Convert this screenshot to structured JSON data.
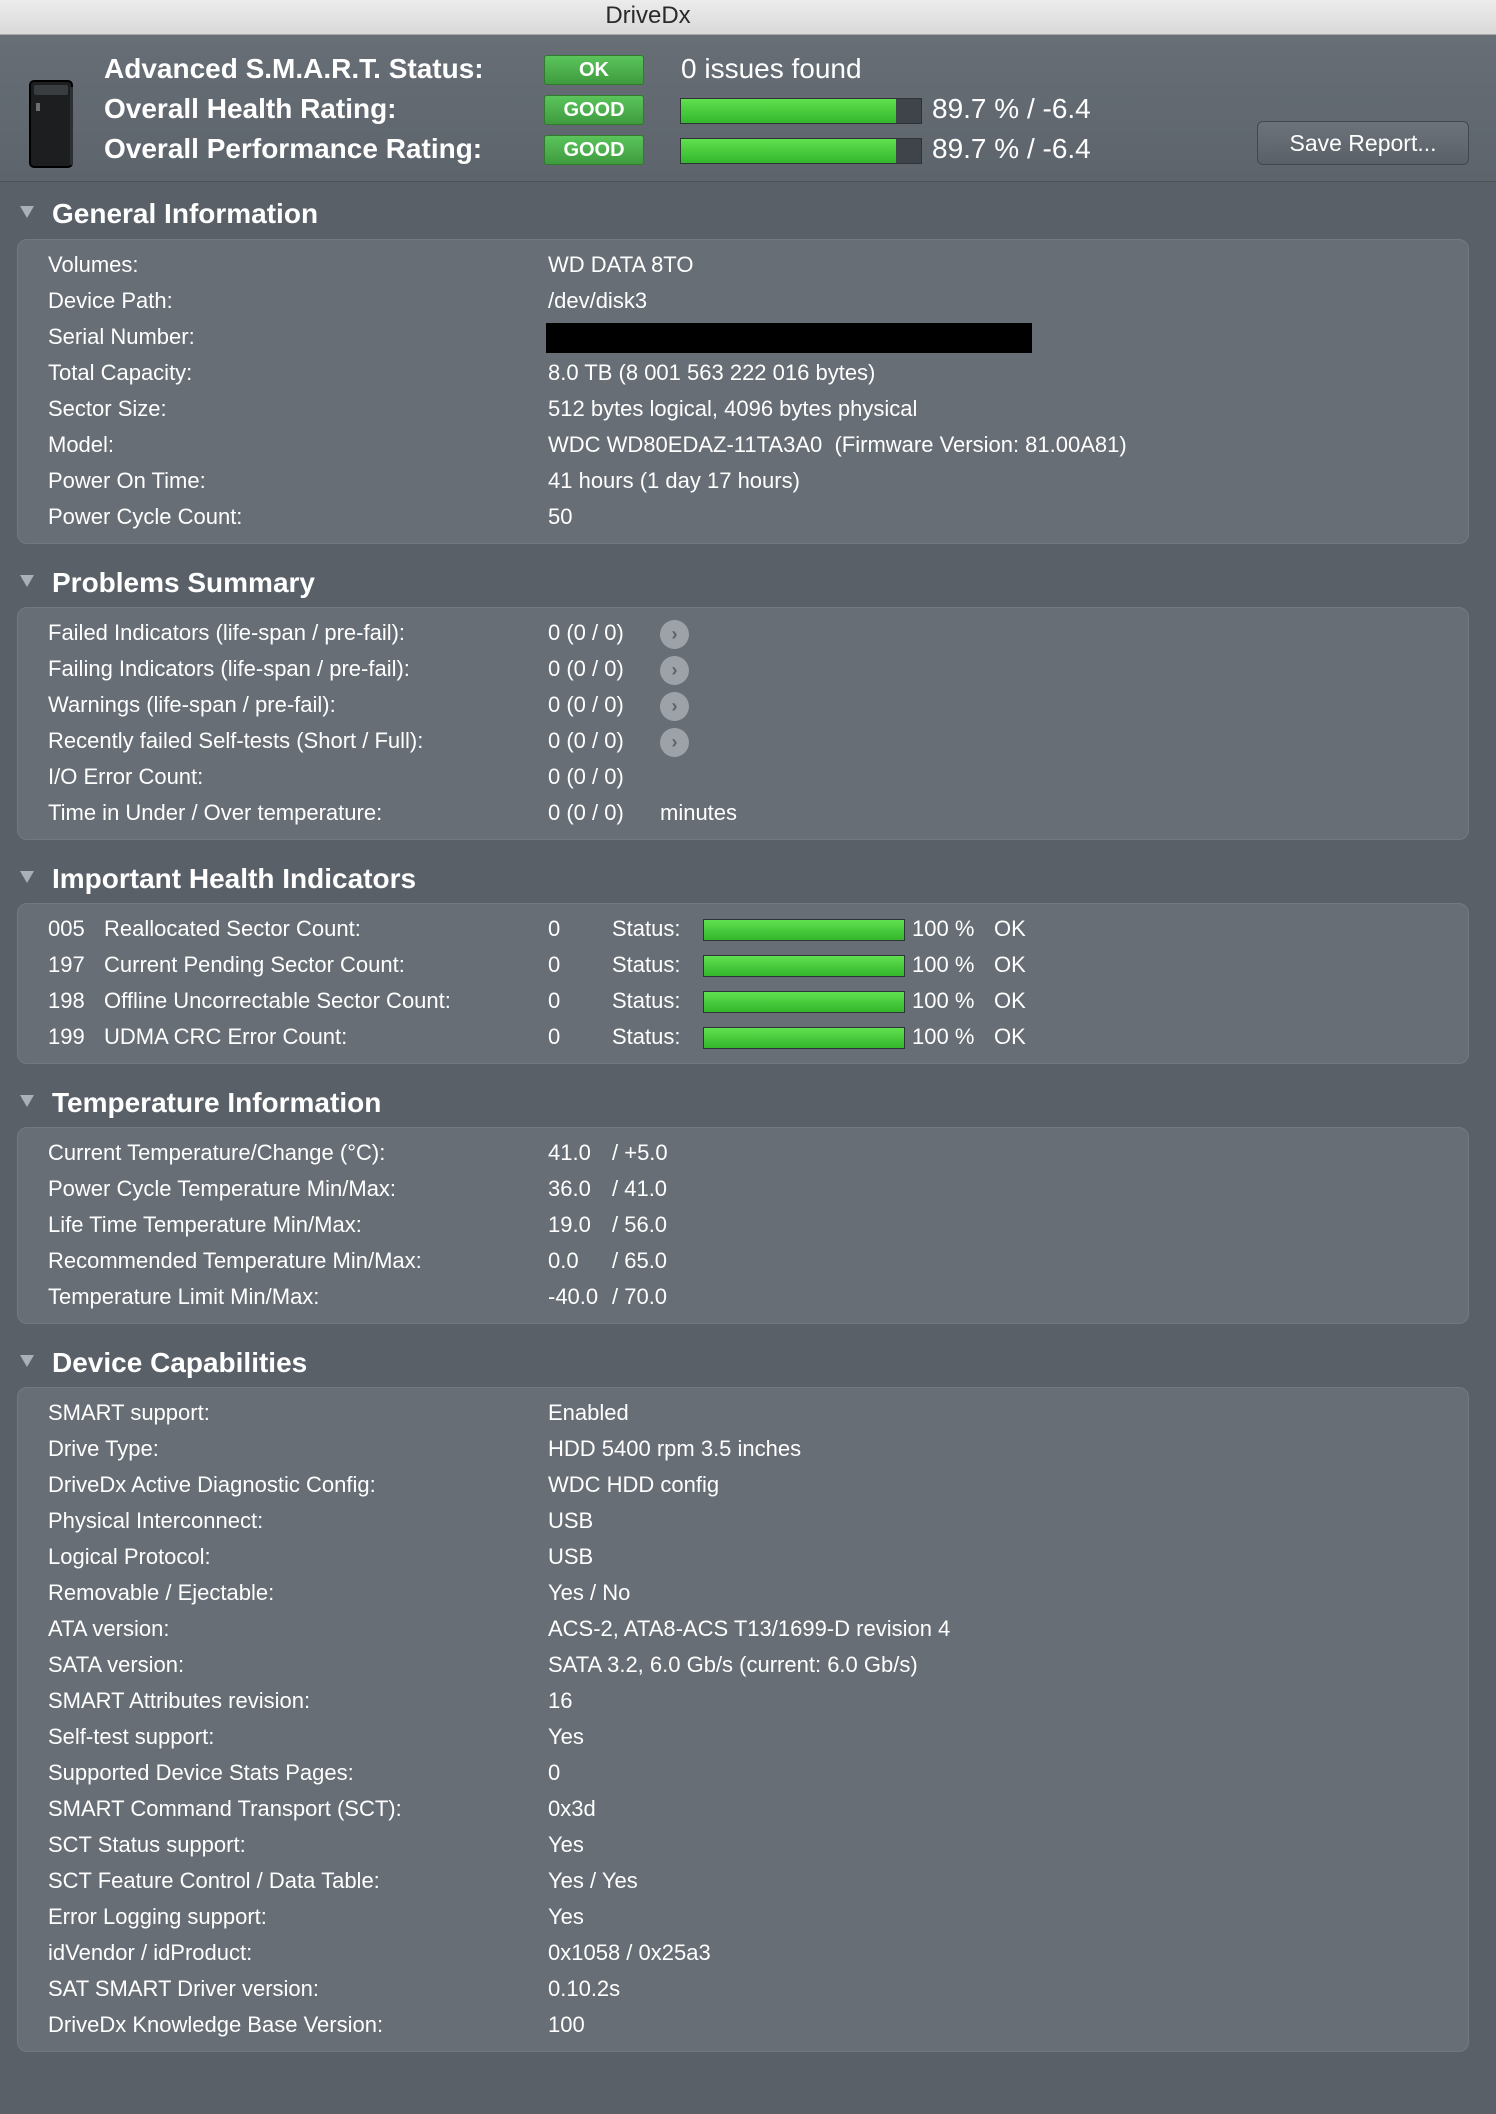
{
  "window": {
    "title": "DriveDx"
  },
  "header": {
    "smart_label": "Advanced S.M.A.R.T. Status:",
    "smart_badge": "OK",
    "smart_text": "0 issues found",
    "health_label": "Overall Health Rating:",
    "health_badge": "GOOD",
    "health_percent": 89.7,
    "health_text": "89.7 % / -6.4",
    "perf_label": "Overall Performance Rating:",
    "perf_badge": "GOOD",
    "perf_percent": 89.7,
    "perf_text": "89.7 % / -6.4",
    "save_button": "Save Report..."
  },
  "general": {
    "title": "General Information",
    "rows": [
      {
        "label": "Volumes:",
        "value": "WD DATA 8TO"
      },
      {
        "label": "Device Path:",
        "value": "/dev/disk3"
      },
      {
        "label": "Serial Number:",
        "value": ""
      },
      {
        "label": "Total Capacity:",
        "value": "8.0 TB (8 001 563 222 016 bytes)"
      },
      {
        "label": "Sector Size:",
        "value": "512 bytes logical, 4096 bytes physical"
      },
      {
        "label": "Model:",
        "value": "WDC WD80EDAZ-11TA3A0  (Firmware Version: 81.00A81)"
      },
      {
        "label": "Power On Time:",
        "value": "41 hours (1 day 17 hours)"
      },
      {
        "label": "Power Cycle Count:",
        "value": "50"
      }
    ]
  },
  "problems": {
    "title": "Problems Summary",
    "rows": [
      {
        "label": "Failed Indicators (life-span / pre-fail):",
        "value": "0 (0 / 0)"
      },
      {
        "label": "Failing Indicators (life-span / pre-fail):",
        "value": "0 (0 / 0)"
      },
      {
        "label": "Warnings (life-span / pre-fail):",
        "value": "0 (0 / 0)"
      },
      {
        "label": "Recently failed Self-tests (Short / Full):",
        "value": "0 (0 / 0)"
      },
      {
        "label": "I/O Error Count:",
        "value": "0 (0 / 0)"
      },
      {
        "label": "Time in Under / Over temperature:",
        "value": "0 (0 / 0)",
        "unit": "minutes"
      }
    ]
  },
  "health": {
    "title": "Important Health Indicators",
    "status_label": "Status:",
    "rows": [
      {
        "id": "005",
        "name": "Reallocated Sector Count:",
        "value": "0",
        "percent": 100,
        "percent_text": "100 %",
        "state": "OK"
      },
      {
        "id": "197",
        "name": "Current Pending Sector Count:",
        "value": "0",
        "percent": 100,
        "percent_text": "100 %",
        "state": "OK"
      },
      {
        "id": "198",
        "name": "Offline Uncorrectable Sector Count:",
        "value": "0",
        "percent": 100,
        "percent_text": "100 %",
        "state": "OK"
      },
      {
        "id": "199",
        "name": "UDMA CRC Error Count:",
        "value": "0",
        "percent": 100,
        "percent_text": "100 %",
        "state": "OK"
      }
    ]
  },
  "temperature": {
    "title": "Temperature Information",
    "rows": [
      {
        "label": "Current Temperature/Change (°C):",
        "a": "41.0",
        "b": "/ +5.0"
      },
      {
        "label": "Power Cycle Temperature Min/Max:",
        "a": "36.0",
        "b": "/ 41.0"
      },
      {
        "label": "Life Time Temperature Min/Max:",
        "a": "19.0",
        "b": "/ 56.0"
      },
      {
        "label": "Recommended Temperature Min/Max:",
        "a": "0.0",
        "b": "/ 65.0"
      },
      {
        "label": "Temperature Limit Min/Max:",
        "a": "-40.0",
        "b": "/ 70.0"
      }
    ]
  },
  "capabilities": {
    "title": "Device Capabilities",
    "rows": [
      {
        "label": "SMART support:",
        "value": "Enabled"
      },
      {
        "label": "Drive Type:",
        "value": "HDD 5400 rpm 3.5 inches"
      },
      {
        "label": "DriveDx Active Diagnostic Config:",
        "value": "WDC HDD config"
      },
      {
        "label": "Physical Interconnect:",
        "value": "USB"
      },
      {
        "label": "Logical Protocol:",
        "value": "USB"
      },
      {
        "label": "Removable / Ejectable:",
        "value": "Yes / No"
      },
      {
        "label": "ATA version:",
        "value": "ACS-2, ATA8-ACS T13/1699-D revision 4"
      },
      {
        "label": "SATA version:",
        "value": "SATA 3.2, 6.0 Gb/s (current: 6.0 Gb/s)"
      },
      {
        "label": "SMART Attributes revision:",
        "value": "16"
      },
      {
        "label": "Self-test support:",
        "value": "Yes"
      },
      {
        "label": "Supported Device Stats Pages:",
        "value": "0"
      },
      {
        "label": "SMART Command Transport (SCT):",
        "value": "0x3d"
      },
      {
        "label": "SCT Status support:",
        "value": "Yes"
      },
      {
        "label": "SCT Feature Control / Data Table:",
        "value": "Yes / Yes"
      },
      {
        "label": "Error Logging support:",
        "value": "Yes"
      },
      {
        "label": "idVendor / idProduct:",
        "value": "0x1058 / 0x25a3"
      },
      {
        "label": "SAT SMART Driver version:",
        "value": "0.10.2s"
      },
      {
        "label": "DriveDx Knowledge Base Version:",
        "value": "100"
      }
    ]
  }
}
